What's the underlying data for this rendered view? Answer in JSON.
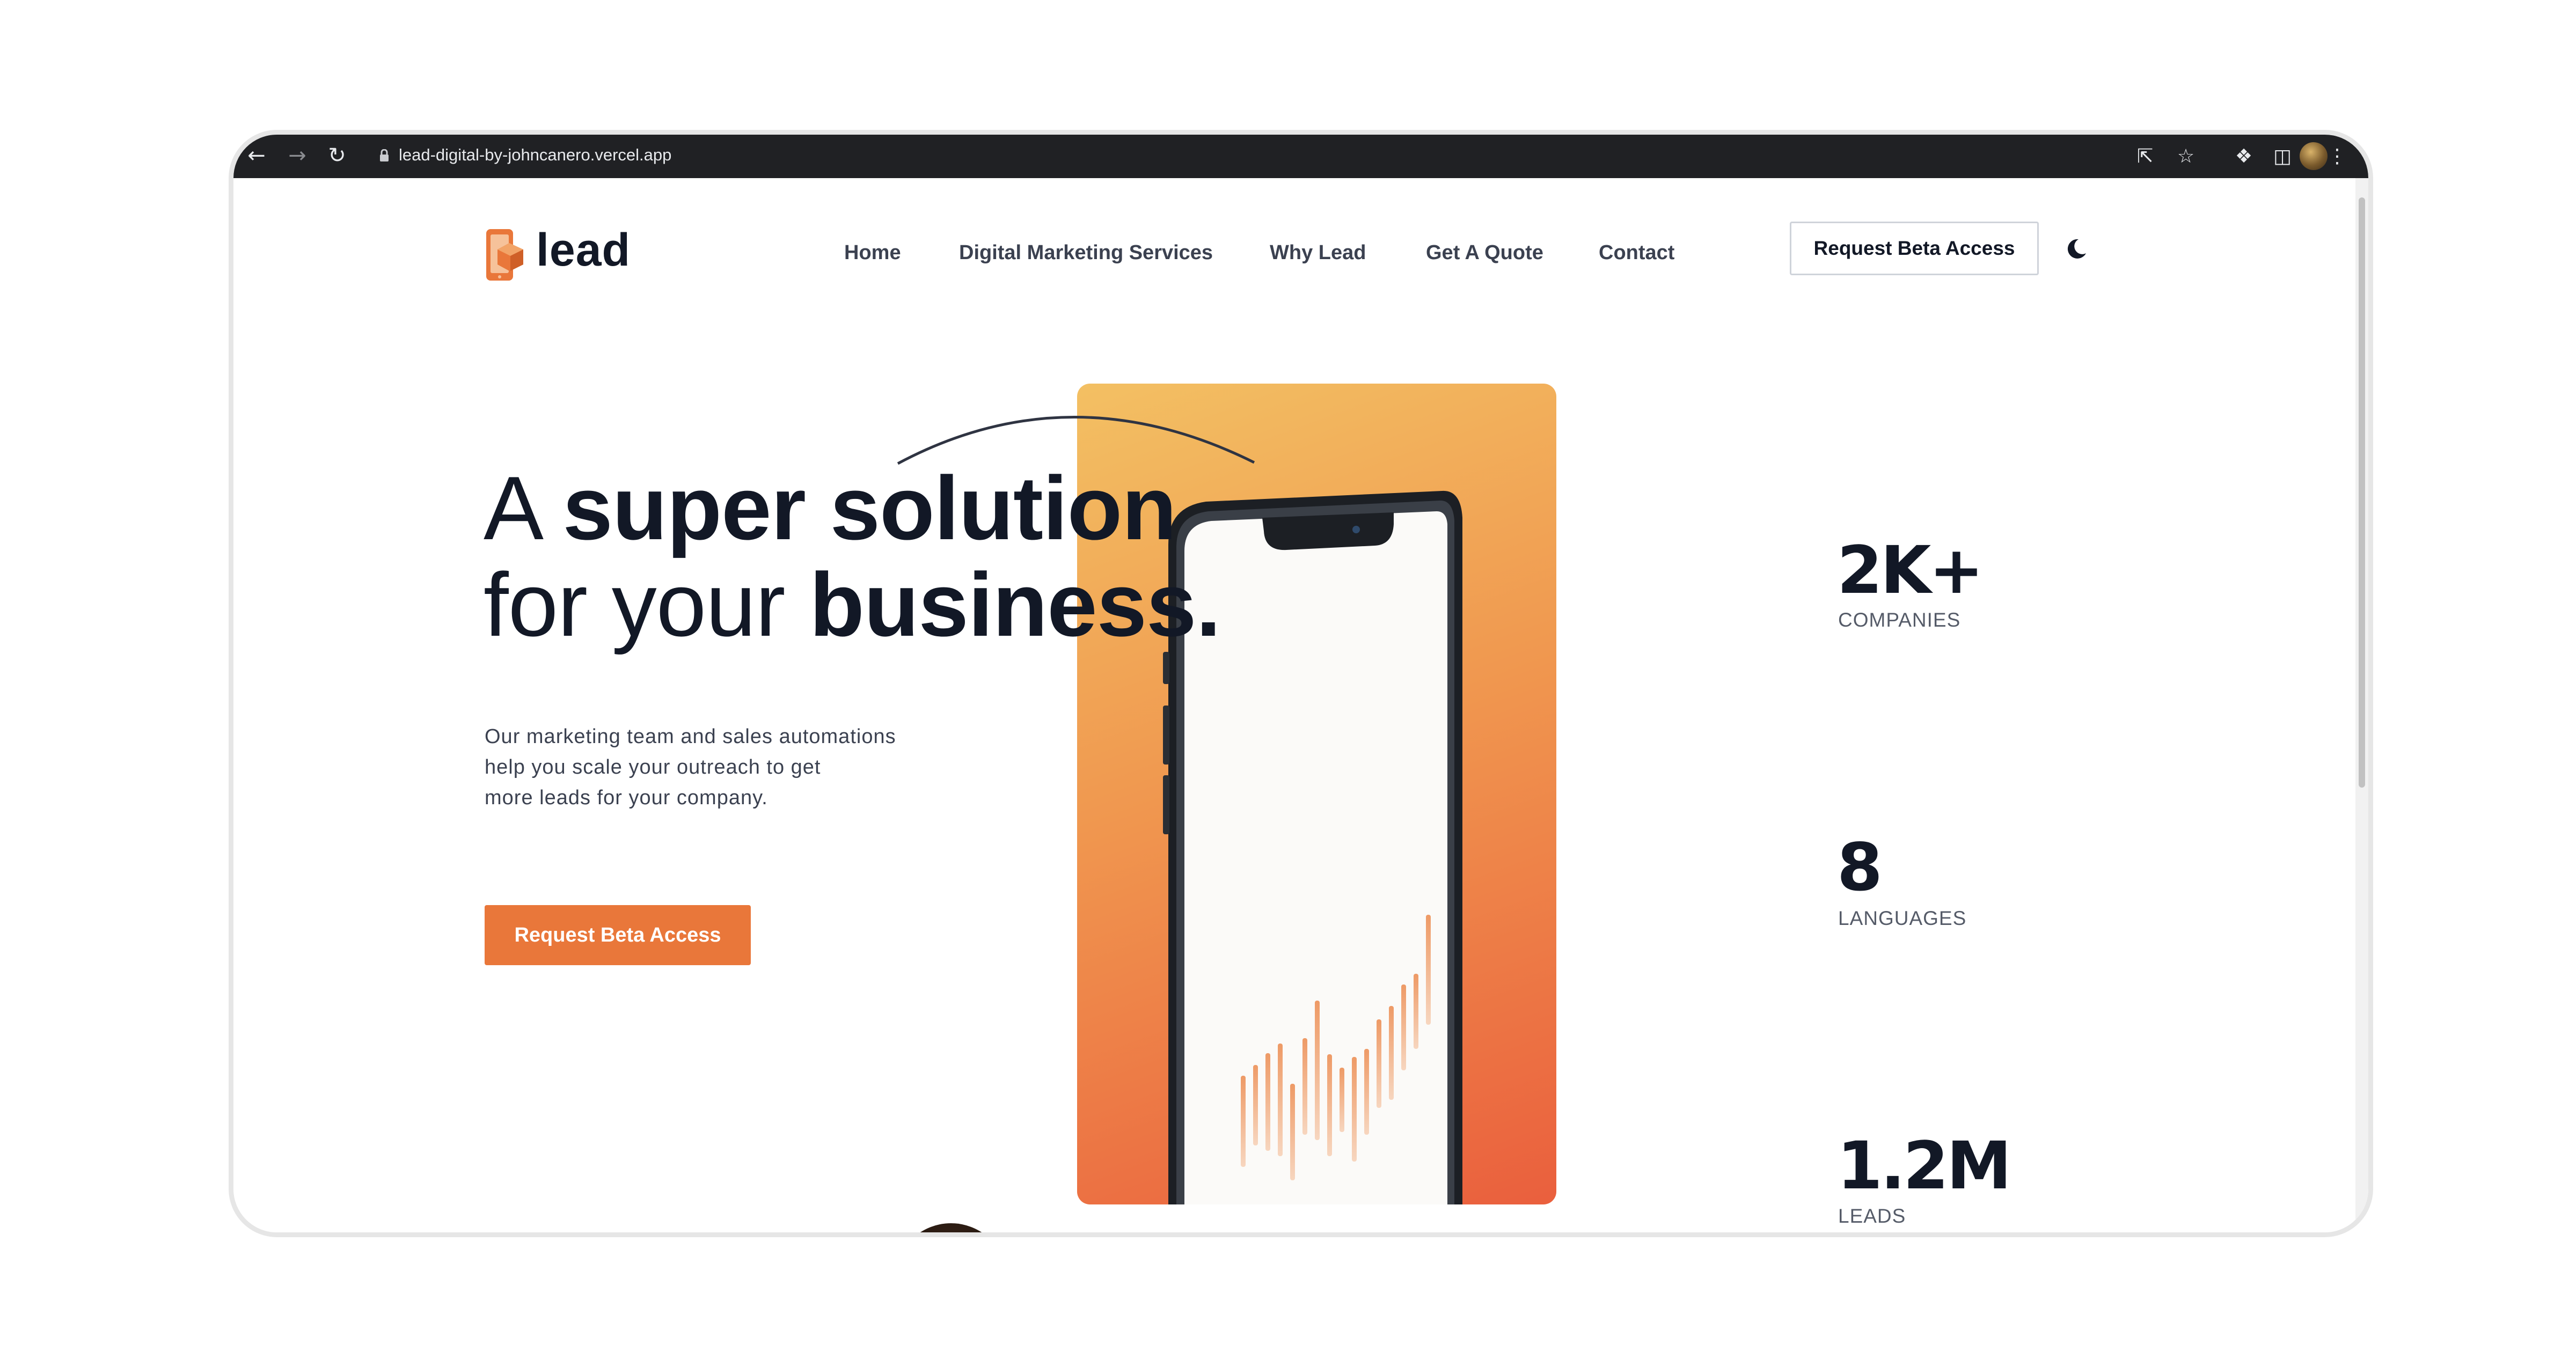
{
  "browser": {
    "url": "lead-digital-by-johncanero.vercel.app"
  },
  "site": {
    "brand": "lead",
    "nav": [
      "Home",
      "Digital Marketing Services",
      "Why Lead",
      "Get A Quote",
      "Contact"
    ],
    "header_cta": "Request Beta Access"
  },
  "hero": {
    "headline_line1_light": "A ",
    "headline_line1_bold": "super solution",
    "headline_line2_light": "for your ",
    "headline_line2_bold": "business.",
    "description_lines": [
      "Our marketing team and sales automations",
      "help you scale your outreach to get",
      "more leads for your company."
    ],
    "cta": "Request Beta Access"
  },
  "stats": [
    {
      "value": "2K+",
      "label": "COMPANIES"
    },
    {
      "value": "8",
      "label": "LANGUAGES"
    },
    {
      "value": "1.2M",
      "label": "LEADS"
    }
  ],
  "colors": {
    "accent": "#e9773a",
    "text_dark": "#121826",
    "chrome_bar": "#202124"
  }
}
